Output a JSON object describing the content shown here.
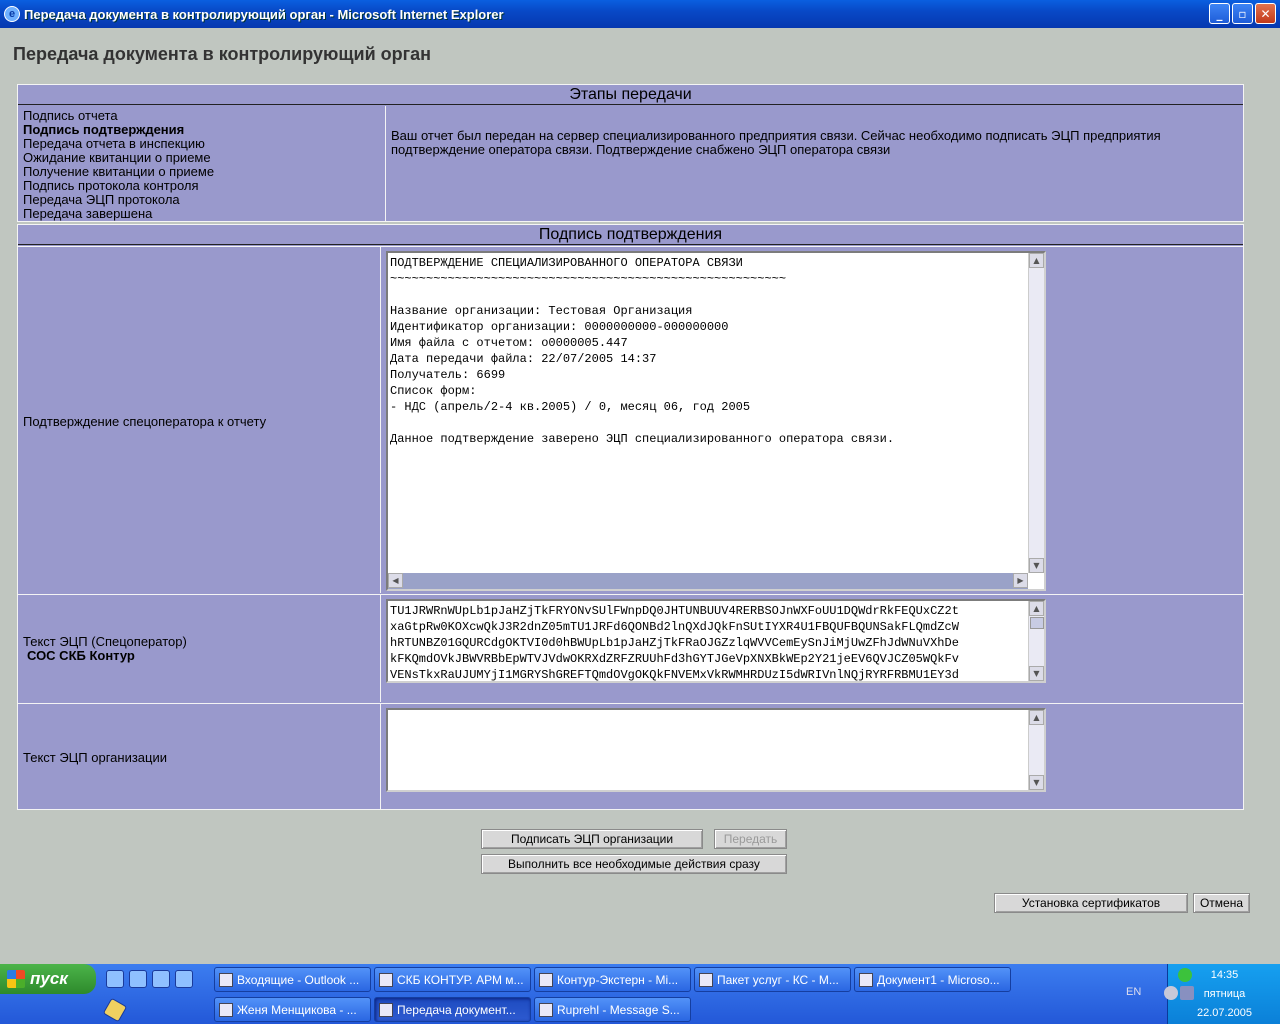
{
  "window": {
    "title": "Передача документа в контролирующий орган - Microsoft Internet Explorer",
    "min": "_",
    "max": "▫",
    "close": "✕"
  },
  "page": {
    "title": "Передача документа в контролирующий орган"
  },
  "stages": {
    "header": "Этапы передачи",
    "items": [
      "Подпись отчета",
      "Подпись подтверждения",
      "Передача отчета в инспекцию",
      "Ожидание квитанции о приеме",
      "Получение квитанции о приеме",
      "Подпись протокола контроля",
      "Передача ЭЦП протокола",
      "Передача завершена"
    ],
    "active_index": 1,
    "description": "Ваш отчет был передан на сервер специализированного предприятия связи. Сейчас необходимо подписать ЭЦП предприятия подтверждение оператора связи. Подтверждение снабжено ЭЦП оператора связи"
  },
  "sign": {
    "header": "Подпись подтверждения",
    "confirmation_label": "Подтверждение спецоператора к отчету",
    "confirmation_text": "ПОДТВЕРЖДЕНИЕ СПЕЦИАЛИЗИРОВАННОГО ОПЕРАТОРА СВЯЗИ\n~~~~~~~~~~~~~~~~~~~~~~~~~~~~~~~~~~~~~~~~~~~~~~~~~~~~~~~\n\nНазвание организации: Тестовая Организация\nИдентификатор организации: 0000000000-000000000\nИмя файла с отчетом: o0000005.447\nДата передачи файла: 22/07/2005 14:37\nПолучатель: 6699\nСписок форм:\n- НДС (апрель/2-4 кв.2005) / 0, месяц 06, год 2005\n\nДанное подтверждение заверено ЭЦП специализированного оператора связи.",
    "operator_sig_label": "Текст ЭЦП (Спецоператор)",
    "operator_name": "СОС СКБ Контур",
    "operator_sig_text": "TU1JRWRnWUpLb1pJaHZjTkFRYONvSUlFWnpDQ0JHTUNBUUV4RERBSOJnWXFoUU1DQWdrRkFEQUxCZ2t\nxaGtpRw0KOXcwQkJ3R2dnZ05mTU1JRFd6QONBd2lnQXdJQkFnSUtIYXR4U1FBQUFBQUNSakFLQmdZcW\nhRTUNBZ01GQURCdgOKTVI0d0hBWUpLb1pJaHZjTkFRaOJGZzlqWVVCemEySnJiMjUwZFhJdWNuVXhDe\nkFKQmdOVkJBWVRBbEpWTVJVdwOKRXdZRFZRUUhFd3hGYTJGeVpXNXBkWEp2Y21jeEV6QVJCZ05WQkFv\nVENsTkxRaUJUMYjI1MGRYShGREFTQmdOVgOKQkFNVEMxVkRWMHRDUzI5dWRIVnlNQjRYRFRBMU1EY3d",
    "org_sig_label": "Текст ЭЦП организации",
    "org_sig_text": ""
  },
  "buttons": {
    "sign_org": "Подписать ЭЦП организации",
    "transmit": "Передать",
    "do_all": "Выполнить все необходимые действия сразу",
    "install_certs": "Установка сертификатов",
    "cancel": "Отмена"
  },
  "taskbar": {
    "start": "пуск",
    "tasks_row1": [
      "Входящие - Outlook ...",
      "СКБ КОНТУР. АРМ м...",
      "Контур-Экстерн - Mi...",
      "Пакет услуг - КС - M...",
      "Документ1 - Microso..."
    ],
    "tasks_row2": [
      "Женя Менщикова - ...",
      "Передача документ...",
      "Ruprehl - Message S..."
    ],
    "lang": "EN",
    "time": "14:35",
    "weekday": "пятница",
    "date": "22.07.2005"
  }
}
